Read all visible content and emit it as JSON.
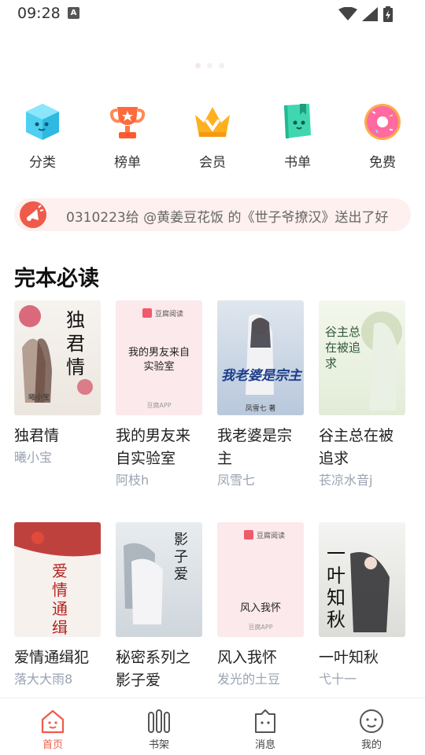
{
  "status": {
    "time": "09:28",
    "a_badge": "A"
  },
  "quick_nav": [
    {
      "label": "分类",
      "icon": "category-cube-icon"
    },
    {
      "label": "榜单",
      "icon": "trophy-icon"
    },
    {
      "label": "会员",
      "icon": "crown-icon"
    },
    {
      "label": "书单",
      "icon": "book-list-icon"
    },
    {
      "label": "免费",
      "icon": "donut-icon"
    }
  ],
  "ticker": {
    "text": "0310223给 @黄姜豆花饭 的《世子爷撩汉》送出了好",
    "icon": "megaphone-icon"
  },
  "section": {
    "title": "完本必读"
  },
  "books": [
    {
      "title": "独君情",
      "author": "曦小宝",
      "cover_text": "独君情",
      "cover_sub": "曦小宝"
    },
    {
      "title": "我的男友来自实验室",
      "author": "阿枝h",
      "cover_text": "我的男友来自实验室",
      "cover_brand": "豆腐阅读",
      "cover_footer": "豆腐APP"
    },
    {
      "title": "我老婆是宗主",
      "author": "凤雪七",
      "cover_text": "我老婆是宗主",
      "cover_sub": "凤雪七 著"
    },
    {
      "title": "谷主总在被追求",
      "author": "苌凉水音j",
      "cover_text": "谷主总在被追求"
    },
    {
      "title": "爱情通缉犯",
      "author": "落大大雨8",
      "cover_text": "爱情通缉犯"
    },
    {
      "title": "秘密系列之影子爱",
      "author": "",
      "cover_text": "影子爱"
    },
    {
      "title": "风入我怀",
      "author": "发光的土豆",
      "cover_text": "风入我怀",
      "cover_brand": "豆腐阅读",
      "cover_footer": "豆腐APP"
    },
    {
      "title": "一叶知秋",
      "author": "弋十一",
      "cover_text": "一叶知秋"
    }
  ],
  "tabs": [
    {
      "label": "首页",
      "icon": "home-icon",
      "active": true
    },
    {
      "label": "书架",
      "icon": "bookshelf-icon"
    },
    {
      "label": "消息",
      "icon": "message-icon"
    },
    {
      "label": "我的",
      "icon": "profile-icon"
    }
  ],
  "colors": {
    "accent": "#f05a4a",
    "ticker_bg": "#fdf0ef",
    "author": "#9aa3b2"
  }
}
